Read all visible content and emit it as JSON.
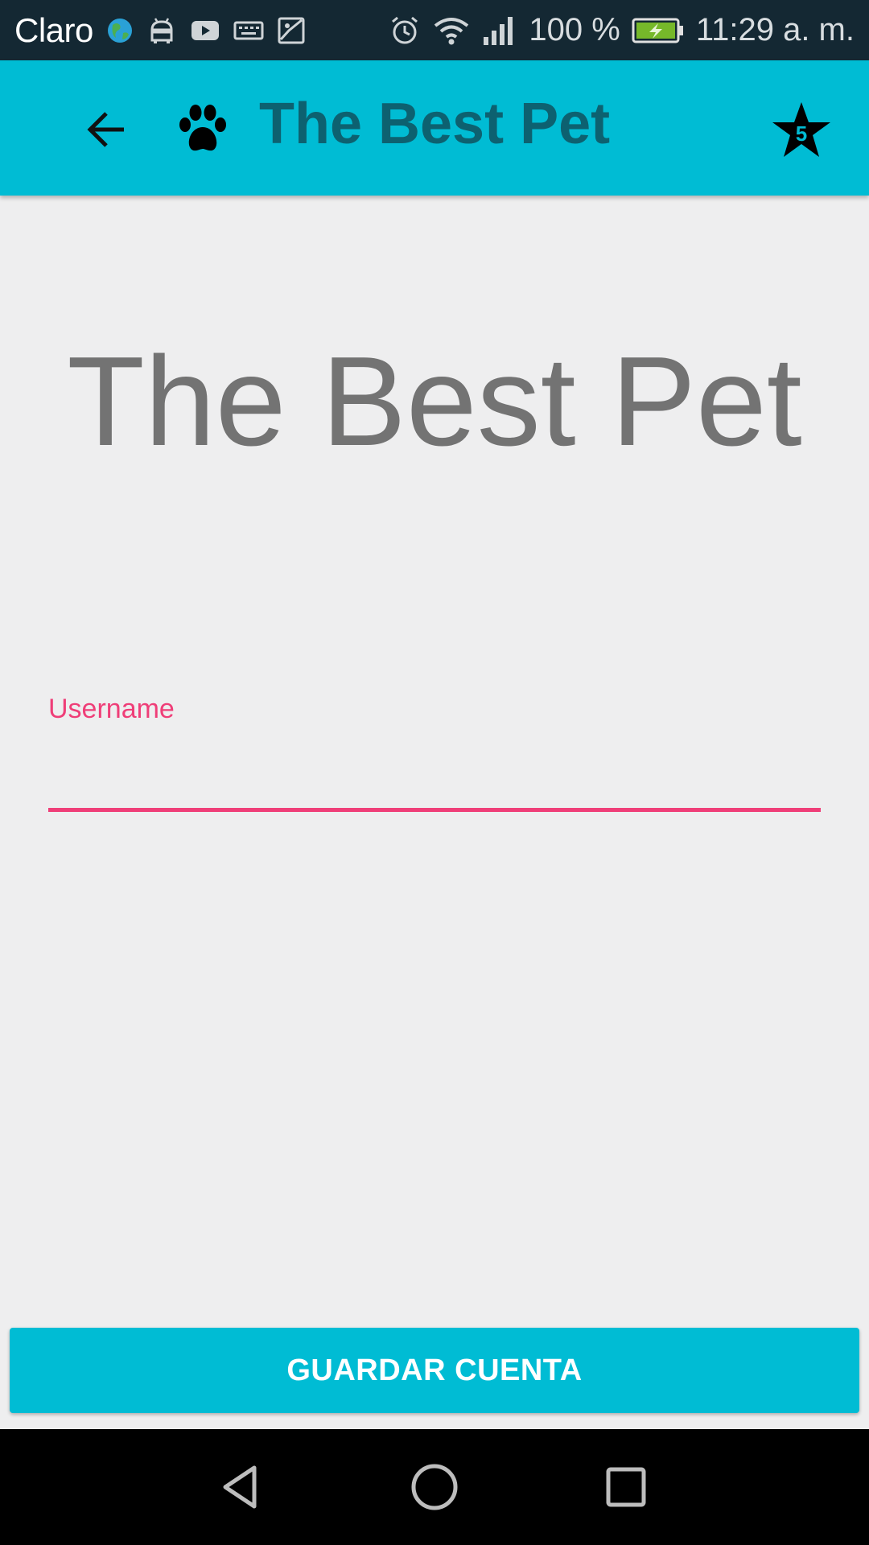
{
  "status_bar": {
    "carrier": "Claro",
    "battery_percent": "100 %",
    "time": "11:29 a. m.",
    "icons": [
      "globe-icon",
      "android-icon",
      "youtube-icon",
      "keyboard-icon",
      "image-icon",
      "alarm-icon",
      "wifi-icon",
      "signal-icon",
      "battery-charging-icon"
    ]
  },
  "app_bar": {
    "title": "The Best Pet",
    "back_icon": "arrow-back-icon",
    "logo_icon": "paw-icon",
    "star_badge": "5",
    "color": "#00bcd4",
    "title_color": "#0d6170"
  },
  "main": {
    "heading": "The Best Pet",
    "username": {
      "label": "Username",
      "value": "",
      "accent_color": "#ef3e78"
    }
  },
  "actions": {
    "save_label": "GUARDAR CUENTA"
  },
  "nav_bar": {
    "buttons": [
      "back-triangle-icon",
      "home-circle-icon",
      "recents-square-icon"
    ]
  }
}
